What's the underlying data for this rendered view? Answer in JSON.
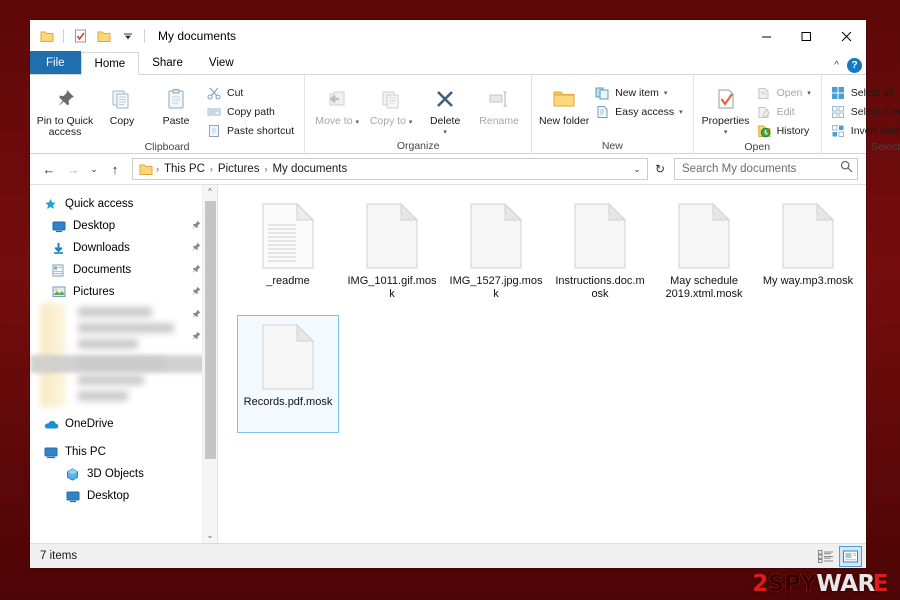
{
  "window": {
    "title": "My documents",
    "quick_access_icons": [
      "folder-icon",
      "properties-icon",
      "new-folder-icon",
      "customize-dropdown-icon"
    ],
    "controls": {
      "minimize": "minimize-icon",
      "maximize": "maximize-icon",
      "close": "close-icon"
    }
  },
  "tabs": [
    {
      "label": "File",
      "id": "file"
    },
    {
      "label": "Home",
      "id": "home"
    },
    {
      "label": "Share",
      "id": "share"
    },
    {
      "label": "View",
      "id": "view"
    }
  ],
  "ribbon": {
    "collapse_icon": "chevron-up-icon",
    "help_icon": "help-icon",
    "help_glyph": "?",
    "groups": [
      {
        "label": "Clipboard",
        "big": [
          {
            "label": "Pin to Quick access",
            "icon": "pin-icon"
          },
          {
            "label": "Copy",
            "icon": "copy-icon"
          },
          {
            "label": "Paste",
            "icon": "paste-icon"
          }
        ],
        "small": [
          {
            "label": "Cut",
            "icon": "scissors-icon"
          },
          {
            "label": "Copy path",
            "icon": "copy-path-icon"
          },
          {
            "label": "Paste shortcut",
            "icon": "paste-shortcut-icon"
          }
        ]
      },
      {
        "label": "Organize",
        "big": [
          {
            "label": "Move to",
            "icon": "move-to-icon",
            "caret": "▾",
            "disabled": true
          },
          {
            "label": "Copy to",
            "icon": "copy-to-icon",
            "caret": "▾",
            "disabled": true
          },
          {
            "label": "Delete",
            "icon": "delete-icon",
            "caret": "▾"
          },
          {
            "label": "Rename",
            "icon": "rename-icon",
            "disabled": true
          }
        ]
      },
      {
        "label": "New",
        "big": [
          {
            "label": "New folder",
            "icon": "new-folder-icon"
          }
        ],
        "small": [
          {
            "label": "New item",
            "icon": "new-item-icon",
            "caret": "▾"
          },
          {
            "label": "Easy access",
            "icon": "easy-access-icon",
            "caret": "▾"
          }
        ]
      },
      {
        "label": "Open",
        "big": [
          {
            "label": "Properties",
            "icon": "properties-icon",
            "caret": "▾"
          }
        ],
        "small": [
          {
            "label": "Open",
            "icon": "open-icon",
            "caret": "▾",
            "disabled": true
          },
          {
            "label": "Edit",
            "icon": "edit-icon",
            "disabled": true
          },
          {
            "label": "History",
            "icon": "history-icon"
          }
        ]
      },
      {
        "label": "Select",
        "small": [
          {
            "label": "Select all",
            "icon": "select-all-icon"
          },
          {
            "label": "Select none",
            "icon": "select-none-icon"
          },
          {
            "label": "Invert selection",
            "icon": "invert-selection-icon"
          }
        ]
      }
    ]
  },
  "addressbar": {
    "back_icon": "back-arrow-icon",
    "forward_icon": "forward-arrow-icon",
    "recent_icon": "recent-locations-icon",
    "up_icon": "up-arrow-icon",
    "path_icon": "folder-icon",
    "crumbs": [
      "This PC",
      "Pictures",
      "My documents"
    ],
    "separator": "›",
    "dropdown_icon": "chevron-down-icon",
    "refresh_icon": "refresh-icon",
    "refresh_glyph": "↻"
  },
  "search": {
    "placeholder": "Search My documents",
    "value": "",
    "icon": "search-icon"
  },
  "sidebar": {
    "scroll_up_icon": "scroll-up-icon",
    "scroll_down_icon": "scroll-down-icon",
    "groups": [
      {
        "header": {
          "label": "Quick access",
          "icon": "star-icon"
        },
        "items": [
          {
            "label": "Desktop",
            "icon": "desktop-icon",
            "pinned": true
          },
          {
            "label": "Downloads",
            "icon": "downloads-icon",
            "pinned": true
          },
          {
            "label": "Documents",
            "icon": "documents-icon",
            "pinned": true
          },
          {
            "label": "Pictures",
            "icon": "pictures-icon",
            "pinned": true
          }
        ]
      },
      {
        "header": {
          "label": "OneDrive",
          "icon": "onedrive-icon"
        },
        "items": []
      },
      {
        "header": {
          "label": "This PC",
          "icon": "this-pc-icon"
        },
        "items": [
          {
            "label": "3D Objects",
            "icon": "3d-objects-icon"
          },
          {
            "label": "Desktop",
            "icon": "desktop-icon"
          }
        ]
      }
    ]
  },
  "files": [
    {
      "name": "_readme",
      "icon": "text-document-icon",
      "selected": false
    },
    {
      "name": "IMG_1011.gif.mosk",
      "icon": "blank-file-icon",
      "selected": false
    },
    {
      "name": "IMG_1527.jpg.mosk",
      "icon": "blank-file-icon",
      "selected": false
    },
    {
      "name": "Instructions.doc.mosk",
      "icon": "blank-file-icon",
      "selected": false
    },
    {
      "name": "May schedule 2019.xtml.mosk",
      "icon": "blank-file-icon",
      "selected": false
    },
    {
      "name": "My way.mp3.mosk",
      "icon": "blank-file-icon",
      "selected": false
    },
    {
      "name": "Records.pdf.mosk",
      "icon": "blank-file-icon",
      "selected": true
    }
  ],
  "statusbar": {
    "item_count": "7 items",
    "views": [
      {
        "name": "details-view-icon",
        "active": false
      },
      {
        "name": "large-icons-view-icon",
        "active": true
      }
    ]
  },
  "watermark": {
    "part1": "2",
    "part2": "SPY",
    "part3": "WAR",
    "part4": "E"
  },
  "colors": {
    "desktop_background": "#6d0b0b",
    "file_tab": "#1f6eae",
    "selection": "#7ec0ee",
    "accent": "#1678c2"
  }
}
